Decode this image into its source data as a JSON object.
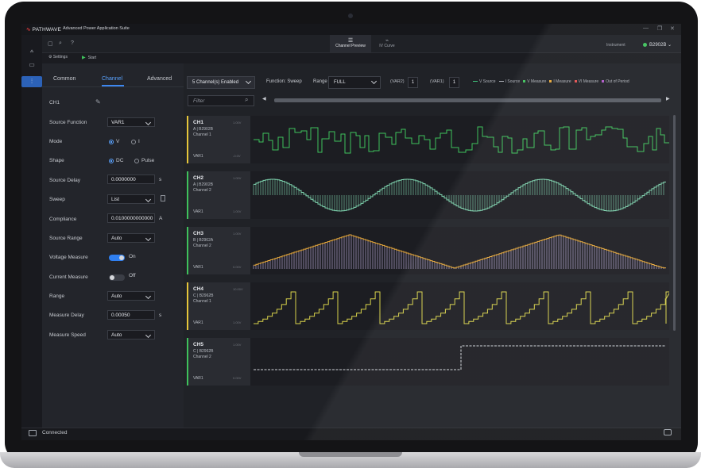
{
  "app": {
    "logo_text": "PATHWAVE",
    "title": "Advanced Power Application Suite",
    "window_controls": [
      "—",
      "❐",
      "✕"
    ]
  },
  "toolbar": {
    "tabs": [
      {
        "label": "Channel Preview",
        "active": true
      },
      {
        "label": "IV Curve",
        "active": false
      }
    ],
    "settings_label": "Settings",
    "start_label": "Start",
    "instrument_label": "Instrument",
    "instrument_value": "B2902B",
    "instrument_status_color": "#3ec25c"
  },
  "left_panel": {
    "tabs": [
      "Common",
      "Channel",
      "Advanced"
    ],
    "active_tab": "Channel",
    "channel_name": "CH1",
    "fields": {
      "source_function": {
        "label": "Source Function",
        "value": "VAR1"
      },
      "mode": {
        "label": "Mode",
        "options": [
          "V",
          "I"
        ],
        "selected": "V"
      },
      "shape": {
        "label": "Shape",
        "options": [
          "DC",
          "Pulse"
        ],
        "selected": "DC"
      },
      "source_delay": {
        "label": "Source Delay",
        "value": "0.0000000",
        "unit": "s"
      },
      "sweep": {
        "label": "Sweep",
        "value": "List"
      },
      "compliance": {
        "label": "Compliance",
        "value": "0.0100000000000",
        "unit": "A"
      },
      "source_range": {
        "label": "Source Range",
        "value": "Auto"
      },
      "voltage_measure": {
        "label": "Voltage Measure",
        "state": "On",
        "on": true
      },
      "current_measure": {
        "label": "Current Measure",
        "state": "Off",
        "on": false
      },
      "range": {
        "label": "Range",
        "value": "Auto"
      },
      "measure_delay": {
        "label": "Measure Delay",
        "value": "0.00050",
        "unit": "s"
      },
      "measure_speed": {
        "label": "Measure Speed",
        "value": "Auto"
      }
    }
  },
  "controls": {
    "channels_enabled": "5 Channel(s) Enabled",
    "function_label": "Function: Sweep",
    "range_label": "Range",
    "range_value": "FULL",
    "var2_label": "(VAR2)",
    "var2_value": "1",
    "var1_label": "(VAR1)",
    "var1_value": "1",
    "filter_placeholder": "Filter"
  },
  "legend": [
    {
      "label": "V Source",
      "color": "#3ec27a",
      "kind": "line"
    },
    {
      "label": "I Source",
      "color": "#b0b4bb",
      "kind": "line"
    },
    {
      "label": "V Measure",
      "color": "#3ec25c",
      "kind": "square"
    },
    {
      "label": "I Measure",
      "color": "#e8a93a",
      "kind": "square"
    },
    {
      "label": "VI Measure",
      "color": "#e25050",
      "kind": "square"
    },
    {
      "label": "Out of Period",
      "color": "#b05ac8",
      "kind": "square"
    }
  ],
  "channels": [
    {
      "name": "CH1",
      "instrument": "A | B2902B",
      "subchannel": "Channel 1",
      "var": "VAR1",
      "bar_color": "#e6c63a",
      "wave": "random-steps",
      "wave_color": "#3ec25c",
      "top_label": "1.00V",
      "bottom_label": "-0.0V"
    },
    {
      "name": "CH2",
      "instrument": "A | B2902B",
      "subchannel": "Channel 2",
      "var": "VAR1",
      "bar_color": "#3ec25c",
      "wave": "sine-staircase",
      "wave_color": "#7fd6b0",
      "top_label": "1.00V",
      "bottom_label": "1.00V"
    },
    {
      "name": "CH3",
      "instrument": "B | B2962A",
      "subchannel": "Channel 2",
      "var": "VAR1",
      "bar_color": "#3ec25c",
      "wave": "triangle-staircase",
      "wave_color": "#e8a93a",
      "top_label": "1.00V",
      "bottom_label": "0.00V"
    },
    {
      "name": "CH4",
      "instrument": "C | B2962B",
      "subchannel": "Channel 1",
      "var": "VAR1",
      "bar_color": "#e6c63a",
      "wave": "sawtooth-steps",
      "wave_color": "#d8d24a",
      "top_label": "10.00V",
      "bottom_label": "1.00V"
    },
    {
      "name": "CH5",
      "instrument": "C | B2962B",
      "subchannel": "Channel 2",
      "var": "VAR1",
      "bar_color": "#3ec25c",
      "wave": "single-step",
      "wave_color": "#d0d3d8",
      "top_label": "1.00V",
      "bottom_label": "0.00V"
    }
  ],
  "status": {
    "text": "Connected"
  }
}
